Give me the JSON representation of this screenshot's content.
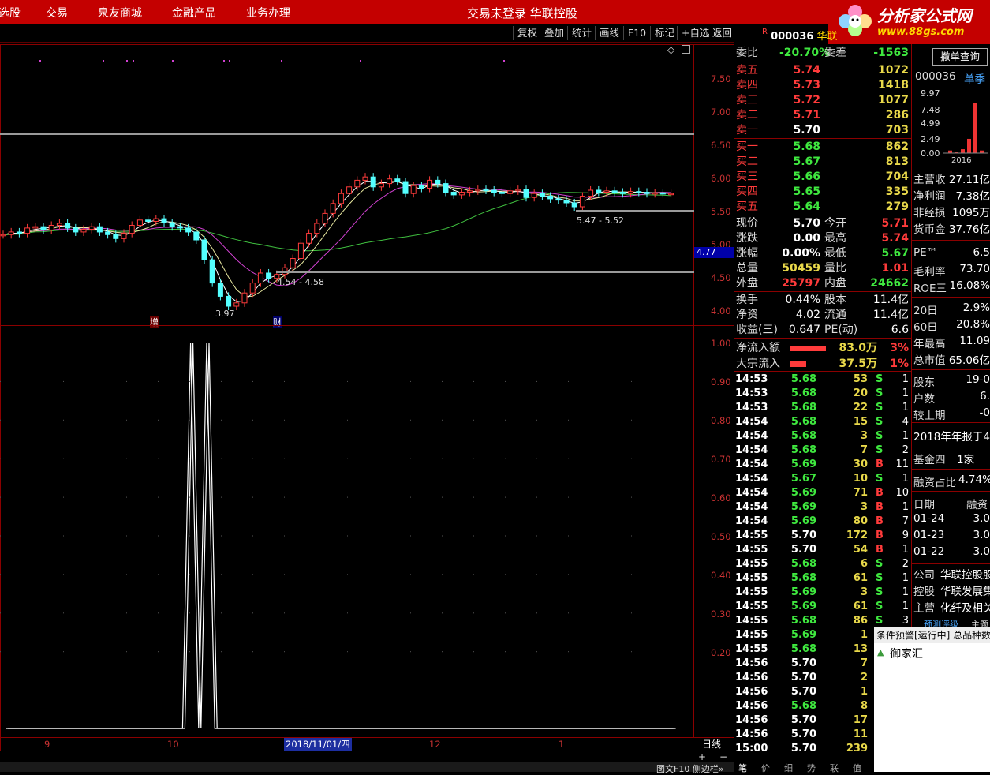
{
  "topbar": {
    "menu": [
      "选股",
      "交易",
      "泉友商城",
      "金融产品",
      "业务办理"
    ],
    "title": "交易未登录   华联控股"
  },
  "brand": {
    "name": "分析家公式网",
    "url": "www.88gs.com"
  },
  "toolbar": {
    "buttons": [
      "复权",
      "叠加",
      "统计",
      "画线",
      "F10",
      "标记",
      "+自选",
      "返回"
    ]
  },
  "stock": {
    "prefix": "R",
    "code": "000036",
    "name": "华联"
  },
  "colors": {
    "bg": "#000000",
    "up": "#ff3b3b",
    "down": "#54ffff",
    "frame": "#8b0000",
    "brand": "#c40000"
  },
  "price_axis": [
    "7.50",
    "7.00",
    "6.50",
    "6.00",
    "5.50",
    "5.00",
    "4.50",
    "4.00"
  ],
  "price_marker": "4.77",
  "main_chart_labels": {
    "low1": "3.97",
    "range1": "4.54 - 4.58",
    "range2": "5.47 - 5.52",
    "event1": "增",
    "event2": "财"
  },
  "indicator_axis": [
    "1.00",
    "0.90",
    "0.80",
    "0.70",
    "0.60",
    "0.50",
    "0.40",
    "0.30",
    "0.20"
  ],
  "date_axis": {
    "labels": [
      "9",
      "10",
      "2018/11/01/四",
      "12",
      "1"
    ],
    "period": "日线"
  },
  "chart_data": {
    "type": "line",
    "title": "",
    "xlabel": "",
    "ylabel": "",
    "ylim": [
      0,
      1
    ],
    "series": [
      {
        "values": [
          0,
          0,
          0,
          0,
          0,
          0,
          0,
          0,
          0,
          0,
          0,
          0,
          0,
          0,
          0,
          0,
          0,
          0,
          0,
          0,
          0,
          0,
          0,
          1,
          0,
          1,
          0,
          0,
          0,
          0,
          0,
          0,
          0,
          0,
          0,
          0,
          0,
          0,
          0,
          0,
          0,
          0,
          0,
          0,
          0,
          0,
          0,
          0,
          0,
          0,
          0,
          0,
          0,
          0,
          0,
          0,
          0,
          0,
          0,
          0,
          0,
          0,
          0,
          0,
          0,
          0,
          0,
          0,
          0,
          0,
          0,
          0,
          0,
          0,
          0,
          0,
          0,
          0,
          0,
          0,
          0,
          0,
          0,
          0
        ]
      }
    ]
  },
  "quote": {
    "weibi_label": "委比",
    "weibi": "-20.70%",
    "weicha_label": "委差",
    "weicha": "-1563",
    "sells": [
      {
        "label": "卖五",
        "price": "5.74",
        "vol": "1072"
      },
      {
        "label": "卖四",
        "price": "5.73",
        "vol": "1418"
      },
      {
        "label": "卖三",
        "price": "5.72",
        "vol": "1077"
      },
      {
        "label": "卖二",
        "price": "5.71",
        "vol": "286"
      },
      {
        "label": "卖一",
        "price": "5.70",
        "vol": "703"
      }
    ],
    "buys": [
      {
        "label": "买一",
        "price": "5.68",
        "vol": "862"
      },
      {
        "label": "买二",
        "price": "5.67",
        "vol": "813"
      },
      {
        "label": "买三",
        "price": "5.66",
        "vol": "704"
      },
      {
        "label": "买四",
        "price": "5.65",
        "vol": "335"
      },
      {
        "label": "买五",
        "price": "5.64",
        "vol": "279"
      }
    ],
    "stats": [
      {
        "l1": "现价",
        "v1": "5.70",
        "c1": "white",
        "l2": "今开",
        "v2": "5.71",
        "c2": "red"
      },
      {
        "l1": "涨跌",
        "v1": "0.00",
        "c1": "white",
        "l2": "最高",
        "v2": "5.74",
        "c2": "red"
      },
      {
        "l1": "涨幅",
        "v1": "0.00%",
        "c1": "white",
        "l2": "最低",
        "v2": "5.67",
        "c2": "green"
      },
      {
        "l1": "总量",
        "v1": "50459",
        "c1": "yellow",
        "l2": "量比",
        "v2": "1.01",
        "c2": "red"
      },
      {
        "l1": "外盘",
        "v1": "25797",
        "c1": "red",
        "l2": "内盘",
        "v2": "24662",
        "c2": "green"
      }
    ],
    "stats2": [
      {
        "l1": "换手",
        "v1": "0.44%",
        "l2": "股本",
        "v2": "11.4亿"
      },
      {
        "l1": "净资",
        "v1": "4.02",
        "l2": "流通",
        "v2": "11.4亿"
      },
      {
        "l1": "收益(三)",
        "v1": "0.647",
        "l2": "PE(动)",
        "v2": "6.6"
      }
    ],
    "flows": [
      {
        "label": "净流入额",
        "value": "83.0万",
        "pct": "3%",
        "fill": 0.9
      },
      {
        "label": "大宗流入",
        "value": "37.5万",
        "pct": "1%",
        "fill": 0.4
      }
    ]
  },
  "ticks": [
    {
      "t": "14:53",
      "p": "5.68",
      "pc": "green",
      "v": "53",
      "d": "S",
      "n": "1"
    },
    {
      "t": "14:53",
      "p": "5.68",
      "pc": "green",
      "v": "20",
      "d": "S",
      "n": "1"
    },
    {
      "t": "14:53",
      "p": "5.68",
      "pc": "green",
      "v": "22",
      "d": "S",
      "n": "1"
    },
    {
      "t": "14:54",
      "p": "5.68",
      "pc": "green",
      "v": "15",
      "d": "S",
      "n": "4"
    },
    {
      "t": "14:54",
      "p": "5.68",
      "pc": "green",
      "v": "3",
      "d": "S",
      "n": "1"
    },
    {
      "t": "14:54",
      "p": "5.68",
      "pc": "green",
      "v": "7",
      "d": "S",
      "n": "2"
    },
    {
      "t": "14:54",
      "p": "5.69",
      "pc": "green",
      "v": "30",
      "d": "B",
      "n": "11"
    },
    {
      "t": "14:54",
      "p": "5.67",
      "pc": "green",
      "v": "10",
      "d": "S",
      "n": "1"
    },
    {
      "t": "14:54",
      "p": "5.69",
      "pc": "green",
      "v": "71",
      "d": "B",
      "n": "10"
    },
    {
      "t": "14:54",
      "p": "5.69",
      "pc": "green",
      "v": "3",
      "d": "B",
      "n": "1"
    },
    {
      "t": "14:54",
      "p": "5.69",
      "pc": "green",
      "v": "80",
      "d": "B",
      "n": "7"
    },
    {
      "t": "14:55",
      "p": "5.70",
      "pc": "white",
      "v": "172",
      "d": "B",
      "n": "9"
    },
    {
      "t": "14:55",
      "p": "5.70",
      "pc": "white",
      "v": "54",
      "d": "B",
      "n": "1"
    },
    {
      "t": "14:55",
      "p": "5.68",
      "pc": "green",
      "v": "6",
      "d": "S",
      "n": "2"
    },
    {
      "t": "14:55",
      "p": "5.68",
      "pc": "green",
      "v": "61",
      "d": "S",
      "n": "1"
    },
    {
      "t": "14:55",
      "p": "5.69",
      "pc": "green",
      "v": "3",
      "d": "S",
      "n": "1"
    },
    {
      "t": "14:55",
      "p": "5.69",
      "pc": "green",
      "v": "61",
      "d": "S",
      "n": "1"
    },
    {
      "t": "14:55",
      "p": "5.68",
      "pc": "green",
      "v": "86",
      "d": "S",
      "n": "3"
    },
    {
      "t": "14:55",
      "p": "5.69",
      "pc": "green",
      "v": "1",
      "d": "",
      "n": ""
    },
    {
      "t": "14:55",
      "p": "5.68",
      "pc": "green",
      "v": "13",
      "d": "",
      "n": ""
    },
    {
      "t": "14:56",
      "p": "5.70",
      "pc": "white",
      "v": "7",
      "d": "",
      "n": ""
    },
    {
      "t": "14:56",
      "p": "5.70",
      "pc": "white",
      "v": "2",
      "d": "",
      "n": ""
    },
    {
      "t": "14:56",
      "p": "5.70",
      "pc": "white",
      "v": "1",
      "d": "",
      "n": ""
    },
    {
      "t": "14:56",
      "p": "5.68",
      "pc": "green",
      "v": "8",
      "d": "",
      "n": ""
    },
    {
      "t": "14:56",
      "p": "5.70",
      "pc": "white",
      "v": "17",
      "d": "",
      "n": ""
    },
    {
      "t": "14:56",
      "p": "5.70",
      "pc": "white",
      "v": "11",
      "d": "",
      "n": ""
    },
    {
      "t": "15:00",
      "p": "5.70",
      "pc": "white",
      "v": "239",
      "d": "",
      "n": ""
    }
  ],
  "side": {
    "cancel_button": "撤单查询",
    "mini_code": "000036",
    "mini_period": "单季",
    "mini_axis": [
      "9.97",
      "7.48",
      "4.99",
      "2.49",
      "0.00"
    ],
    "mini_year": "2016",
    "mini_bars": [
      0.04,
      0.0,
      0.06,
      0.22,
      0.78,
      0.04
    ],
    "rows": [
      {
        "k": "主营收",
        "v": "27.11亿"
      },
      {
        "k": "净利润",
        "v": "7.38亿"
      },
      {
        "k": "非经损",
        "v": "1095万"
      },
      {
        "k": "货币金",
        "v": "37.76亿"
      }
    ],
    "rows2": [
      {
        "k": "PE™",
        "v": "6.5"
      },
      {
        "k": "毛利率",
        "v": "73.70"
      },
      {
        "k": "ROE三",
        "v": "16.08%"
      }
    ],
    "rows3": [
      {
        "k": "20日",
        "v": "2.9%"
      },
      {
        "k": "60日",
        "v": "20.8%"
      },
      {
        "k": "年最高",
        "v": "11.09"
      },
      {
        "k": "总市值",
        "v": "65.06亿"
      }
    ],
    "rows4": [
      {
        "k": "股东",
        "v": "19-0"
      },
      {
        "k": "户数",
        "v": "6."
      },
      {
        "k": "较上期",
        "v": "-0"
      }
    ],
    "report": "2018年年报于4",
    "fund_label": "基金四",
    "fund_value": "1家",
    "margin_label": "融资占比",
    "margin_value": "4.74%",
    "table_head": {
      "date": "日期",
      "val": "融资"
    },
    "table": [
      {
        "d": "01-24",
        "v": "3.0"
      },
      {
        "d": "01-23",
        "v": "3.0"
      },
      {
        "d": "01-22",
        "v": "3.0"
      }
    ],
    "company": [
      {
        "k": "公司",
        "v": "华联控股股"
      },
      {
        "k": "控股",
        "v": "华联发展集"
      },
      {
        "k": "主营",
        "v": "化纤及相关"
      }
    ],
    "forecast": "预测评级",
    "forecast2": "主题",
    "alert": "条件预警[运行中] 总品种数",
    "alert_item": "御家汇"
  },
  "bottom": {
    "tabs": [
      "笔",
      "价",
      "细",
      "势",
      "联",
      "值"
    ],
    "status": "图文F10 侧边栏»"
  }
}
